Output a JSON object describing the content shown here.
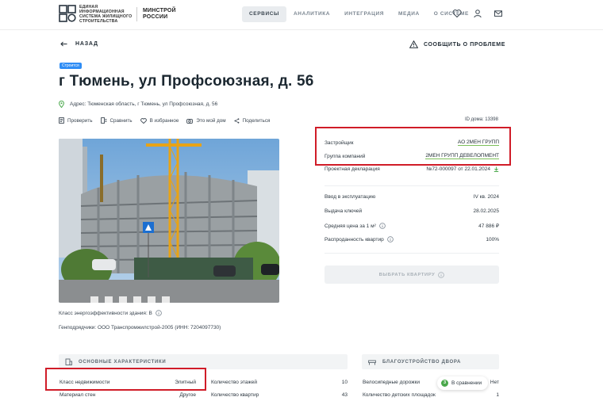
{
  "header": {
    "logo_text": "Единая информационная система жилищного строительства",
    "ministry": "МИНСТРОЙ РОССИИ",
    "nav": [
      "СЕРВИСЫ",
      "АНАЛИТИКА",
      "ИНТЕГРАЦИЯ",
      "МЕДИА",
      "О СИСТЕМЕ"
    ],
    "icons": [
      "heart-icon",
      "user-icon",
      "mail-icon"
    ]
  },
  "back_label": "НАЗАД",
  "report_label": "СООБЩИТЬ О ПРОБЛЕМЕ",
  "badge": "Строится",
  "title": "г Тюмень, ул Профсоюзная, д. 56",
  "address": "Адрес: Тюменская область, г Тюмень, ул Профсоюзная, д. 56",
  "actions": [
    "Проверить",
    "Сравнить",
    "В избранное",
    "Это мой дом",
    "Поделиться"
  ],
  "house_id": "ID дома: 13398",
  "info": {
    "developer_label": "Застройщик",
    "developer_value": "АО 2МЕН ГРУПП",
    "group_label": "Группа компаний",
    "group_value": "2МЕН ГРУПП ДЕВЕЛОПМЕНТ",
    "declaration_label": "Проектная декларация",
    "declaration_value": "№72-000097 от 22.01.2024",
    "commissioning_label": "Ввод в эксплуатацию",
    "commissioning_value": "IV кв. 2024",
    "keys_label": "Выдача ключей",
    "keys_value": "28.02.2025",
    "price_label": "Средняя цена за 1 м²",
    "price_value": "47 886 ₽",
    "sold_label": "Распроданность квартир",
    "sold_value": "100%",
    "select_button": "ВЫБРАТЬ КВАРТИРУ"
  },
  "energy_label": "Класс энергоэффективности здания: В",
  "contractors": "Генподрядчики: ООО Транспромжилстрой-2005 (ИНН: 7204097730)",
  "characteristics": {
    "heading": "ОСНОВНЫЕ ХАРАКТЕРИСТИКИ",
    "rows": [
      {
        "label": "Класс недвижимости",
        "value": "Элитный"
      },
      {
        "label": "Материал стен",
        "value": "Другое"
      },
      {
        "label": "Количество этажей",
        "value": "10"
      },
      {
        "label": "Количество квартир",
        "value": "43"
      }
    ]
  },
  "yard": {
    "heading": "БЛАГОУСТРОЙСТВО ДВОРА",
    "rows": [
      {
        "label": "Велосипедные дорожки",
        "value": "Нет"
      },
      {
        "label": "Количество детских площадок",
        "value": "1"
      }
    ]
  },
  "compare_chip": {
    "count": "3",
    "label": "В сравнении"
  },
  "colors": {
    "accent": "#4aa84b",
    "highlight": "#d01c28",
    "badge": "#2f8df5"
  }
}
